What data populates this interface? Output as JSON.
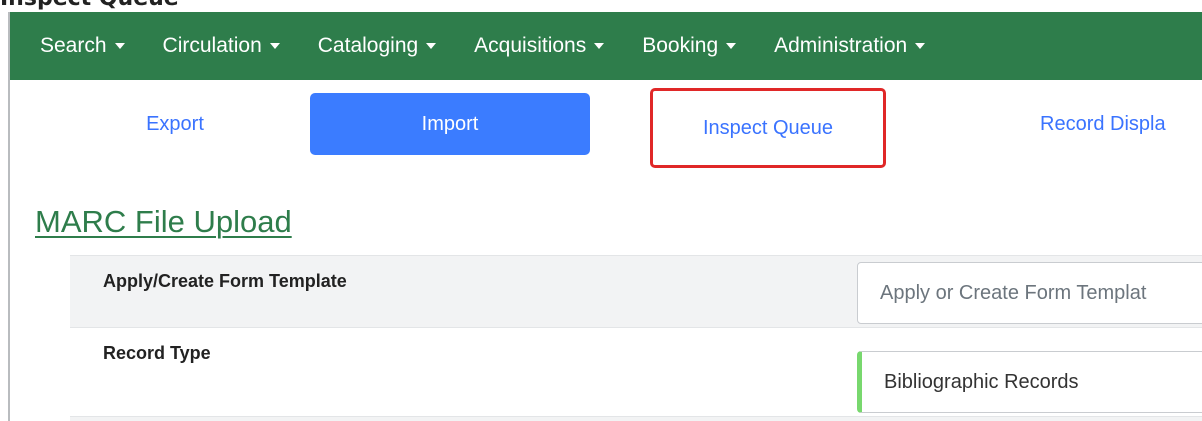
{
  "page_heading": "Inspect Queue",
  "nav": {
    "items": [
      {
        "label": "Search"
      },
      {
        "label": "Circulation"
      },
      {
        "label": "Cataloging"
      },
      {
        "label": "Acquisitions"
      },
      {
        "label": "Booking"
      },
      {
        "label": "Administration"
      }
    ],
    "color": "#2e7d4b"
  },
  "tabs": {
    "export": "Export",
    "import": "Import",
    "inspect": "Inspect Queue",
    "record_display": "Record Displa"
  },
  "section_title": "MARC File Upload",
  "form": {
    "template_label": "Apply/Create Form Template",
    "template_placeholder": "Apply or Create Form Templat",
    "record_type_label": "Record Type",
    "record_type_value": "Bibliographic Records"
  },
  "colors": {
    "accent": "#3b7cff",
    "highlight": "#e02828",
    "valid_field": "#78d86e"
  }
}
